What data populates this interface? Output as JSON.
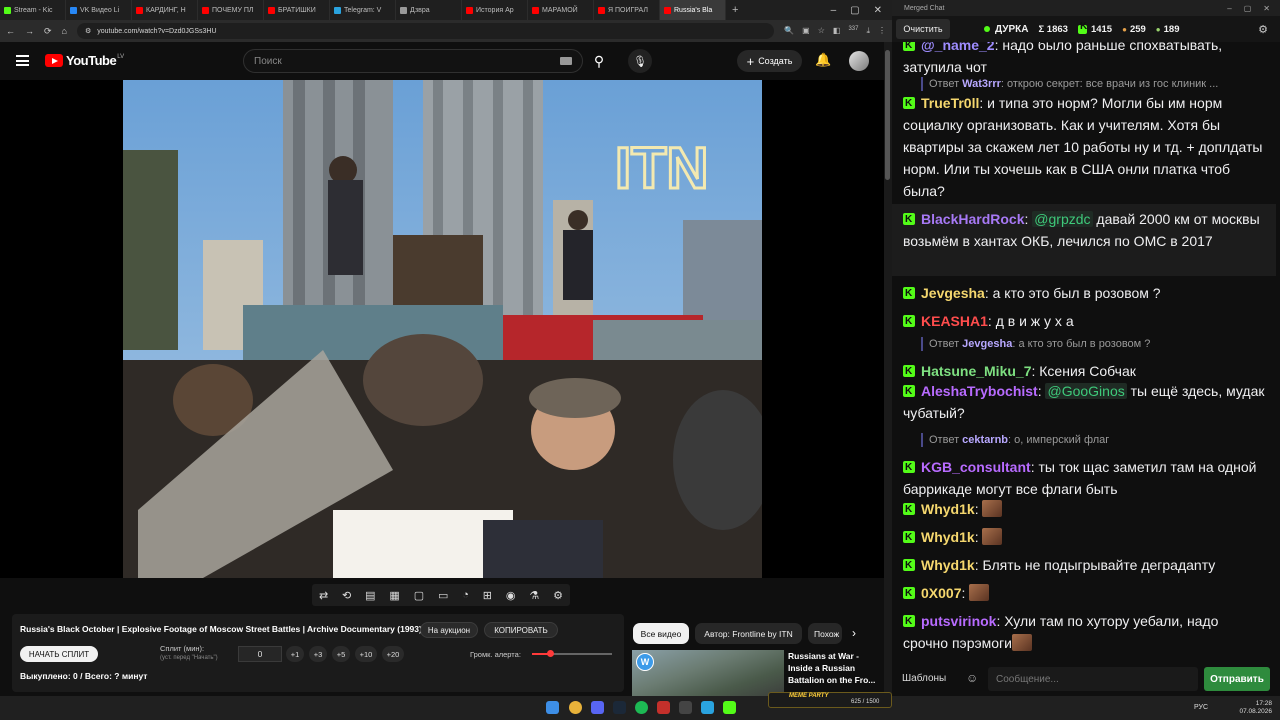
{
  "browser": {
    "tabs": [
      {
        "label": "Stream - Kic",
        "color": "#53fc18"
      },
      {
        "label": "VK Видео Li",
        "color": "#2787f5"
      },
      {
        "label": "КАРДИНГ, Н",
        "color": "#ff0000"
      },
      {
        "label": "ПОЧЕМУ ПЛ",
        "color": "#ff0000"
      },
      {
        "label": "БРАТИШКИ",
        "color": "#ff0000"
      },
      {
        "label": "Telegram: V",
        "color": "#2aa3df"
      },
      {
        "label": "Дзвра",
        "color": "#999999"
      },
      {
        "label": "История Ар",
        "color": "#ff0000"
      },
      {
        "label": "МАРАМОЙ",
        "color": "#ff0000"
      },
      {
        "label": "Я ПОИГРАЛ",
        "color": "#ff0000"
      },
      {
        "label": "Russia's Bla",
        "color": "#ff0000"
      }
    ],
    "new_tab": "+",
    "url": "youtube.com/watch?v=Dzd0JGSs3HU",
    "badge": "337"
  },
  "youtube": {
    "logo": "YouTube",
    "region": "LV",
    "search_placeholder": "Поиск",
    "create_label": "Создать"
  },
  "video": {
    "watermark": "ITN"
  },
  "controls": [
    "⇄",
    "⟲",
    "▤",
    "▦",
    "▢",
    "▭",
    "◔",
    "⊞",
    "◉",
    "⚗",
    "⚙"
  ],
  "panel": {
    "title": "Russia's Black October | Explosive Footage of Moscow Street Battles | Archive Documentary (1993)",
    "auction_btn": "На аукцион",
    "copy_btn": "КОПИРОВАТЬ",
    "start_split": "НАЧАТЬ СПЛИТ",
    "split_label": "Сплит (мин):",
    "split_sub": "(уст. перед \"Начать\")",
    "split_value": "0",
    "increments": [
      "+1",
      "+3",
      "+5",
      "+10",
      "+20"
    ],
    "volume_label": "Громк. алерта:",
    "volume_level": 0.22,
    "bought": "Выкуплено: 0 / Всего: ? минут"
  },
  "chips": {
    "all": "Все видео",
    "author": "Автор: Frontline by ITN",
    "similar": "Похож"
  },
  "related": {
    "title": "Russians at War - Inside a Russian Battalion on the Fro...",
    "badge": "W"
  },
  "chat": {
    "window_title": "Merged Chat",
    "clear": "Очистить",
    "streamer": "ДУРКА",
    "stat_total": "Σ 1863",
    "stat_kick": "1415",
    "stat_other": "259",
    "stat_third": "189",
    "messages": [
      {
        "user": "@_name_2",
        "color": "#9e8cff",
        "text": "надо было раньше спохватывать, затупила чот"
      },
      {
        "reply": true,
        "user": "Wat3rrr",
        "text": "открою секрет: все врачи из гос клиник ..."
      },
      {
        "user": "TrueTr0ll",
        "color": "#f5d76e",
        "text": "и типа это норм? Могли бы им норм социалку организовать. Как и учителям. Хотя бы квартиры за скажем лет 10 работы ну и тд. + доплдаты норм. Или ты хочешь как в США онли платка чтоб была?"
      },
      {
        "user": "BlackHardRock",
        "color": "#a779f5",
        "mention": "@grpzdc",
        "text": "давай 2000 км от москвы возьмём в хантах ОКБ, лечился по ОМС в 2017"
      },
      {
        "user": "Jevgesha",
        "color": "#f5d76e",
        "text": "а кто это был в розовом ?"
      },
      {
        "user": "KEASHA1",
        "color": "#ff4d4d",
        "text": "д в и ж у х а"
      },
      {
        "reply": true,
        "user": "Jevgesha",
        "text": "а кто это был в розовом ?"
      },
      {
        "user": "Hatsune_Miku_7",
        "color": "#7ee081",
        "text": "Ксения Собчак"
      },
      {
        "user": "AleshaTrybochist",
        "color": "#b86bff",
        "mention": "@GooGinos",
        "text": "ты ещё здесь, мудак чубатый?"
      },
      {
        "reply": true,
        "user": "cektarnb",
        "text": "о, имперский флаг"
      },
      {
        "user": "KGB_consultant",
        "color": "#b86bff",
        "text": "ты ток щас заметил там на одной баррикаде могут все флаги быть"
      },
      {
        "user": "Whyd1k",
        "color": "#f5d76e",
        "text": ""
      },
      {
        "user": "Whyd1k",
        "color": "#f5d76e",
        "text": ""
      },
      {
        "user": "Whyd1k",
        "color": "#f5d76e",
        "text": "Блять не подыгрывайте деградanту"
      },
      {
        "user": "0X007",
        "color": "#f5d76e",
        "text": ""
      },
      {
        "user": "putsvirinok",
        "color": "#b86bff",
        "text": "Хули там по хутору уебали, надо срочно пэрэмоги"
      }
    ],
    "templates": "Шаблоны",
    "input_placeholder": "Сообщение...",
    "send": "Отправить"
  },
  "taskbar": {
    "lang": "РУС",
    "time": "17:28",
    "date": "07.08.2026",
    "meme_label": "MEME PARTY",
    "meme_progress": "625 / 1500"
  }
}
